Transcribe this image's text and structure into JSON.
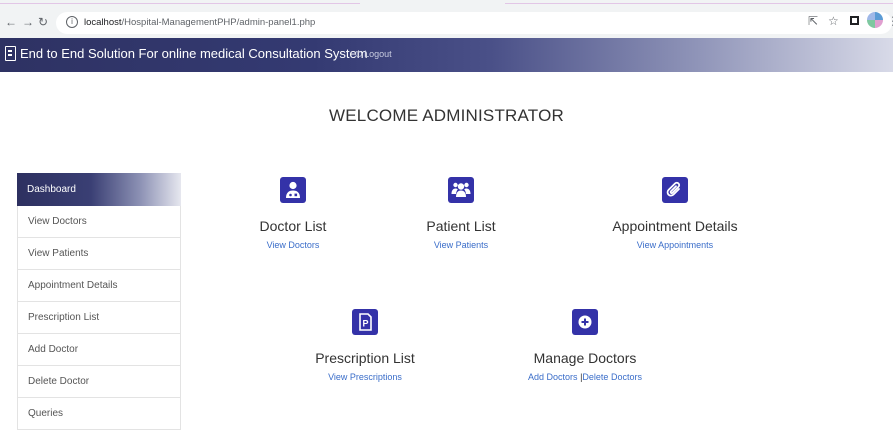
{
  "browser": {
    "url_host": "localhost",
    "url_path": "/Hospital-ManagementPHP/admin-panel1.php"
  },
  "navbar": {
    "brand": "End to End Solution For online medical Consultation System",
    "logout": "Logout"
  },
  "welcome": "WELCOME ADMINISTRATOR",
  "sidebar": {
    "items": [
      {
        "label": "Dashboard"
      },
      {
        "label": "View Doctors"
      },
      {
        "label": "View Patients"
      },
      {
        "label": "Appointment Details"
      },
      {
        "label": "Prescription List"
      },
      {
        "label": "Add Doctor"
      },
      {
        "label": "Delete Doctor"
      },
      {
        "label": "Queries"
      }
    ]
  },
  "cards": {
    "doctor": {
      "title": "Doctor List",
      "link": "View Doctors",
      "icon": "user-doctor-icon"
    },
    "patient": {
      "title": "Patient List",
      "link": "View Patients",
      "icon": "users-icon"
    },
    "appointment": {
      "title": "Appointment Details",
      "link": "View Appointments",
      "icon": "paperclip-icon"
    },
    "prescription": {
      "title": "Prescription List",
      "link": "View Prescriptions",
      "icon": "file-prescription-icon"
    },
    "manage": {
      "title": "Manage Doctors",
      "link1": "Add Doctors",
      "separator": "|",
      "link2": "Delete Doctors",
      "icon": "plus-circle-icon"
    }
  },
  "colors": {
    "accent": "#3432a8",
    "link": "#3a6dc9",
    "navbar_dark": "#2e3263"
  }
}
